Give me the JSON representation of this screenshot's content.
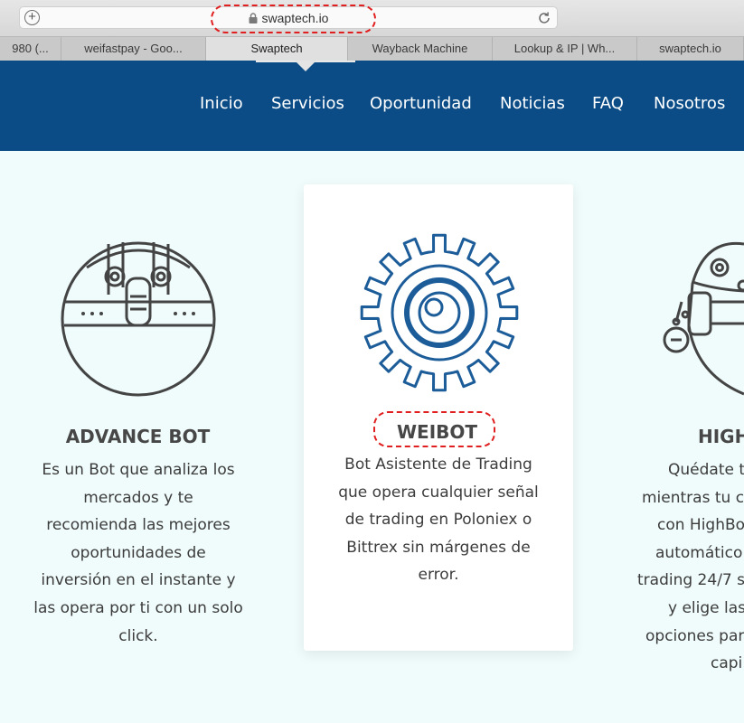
{
  "browser": {
    "url": "swaptech.io",
    "tabs": [
      {
        "label": "980 (...",
        "active": false
      },
      {
        "label": "weifastpay - Goo...",
        "active": false
      },
      {
        "label": "Swaptech",
        "active": true
      },
      {
        "label": "Wayback Machine",
        "active": false
      },
      {
        "label": "Lookup & IP | Wh...",
        "active": false
      },
      {
        "label": "swaptech.io",
        "active": false
      }
    ]
  },
  "nav": {
    "items": [
      "Inicio",
      "Servicios",
      "Oportunidad",
      "Noticias",
      "FAQ",
      "Nosotros"
    ],
    "active": "Servicios"
  },
  "features": [
    {
      "title": "ADVANCE BOT",
      "lines": [
        "Es un Bot que analiza los",
        "mercados y te",
        "recomienda las mejores",
        "oportunidades de",
        "inversión en el instante y",
        "las opera por ti con un solo",
        "click."
      ]
    },
    {
      "title": "WEIBOT",
      "lines": [
        "Bot Asistente de Trading",
        "que opera cualquier señal",
        "de trading en Poloniex o",
        "Bittrex sin márgenes de",
        "error."
      ]
    },
    {
      "title": "HIGH",
      "lines": [
        "Quédate t",
        "mientras tu c",
        "con HighBo",
        "automático",
        "trading 24/7 si",
        "y elige las",
        "opciones par",
        "capi"
      ]
    }
  ],
  "colors": {
    "header_bg": "#0b4c86",
    "page_bg": "#f0fbfb",
    "gear_blue": "#1c5c99",
    "icon_gray": "#444444",
    "annotation_red": "#e02020"
  }
}
